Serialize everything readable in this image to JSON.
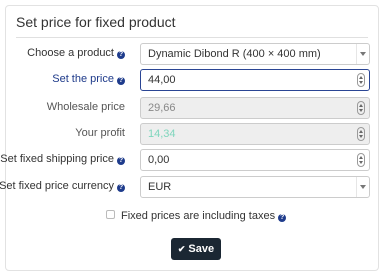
{
  "panel": {
    "title": "Set price for fixed product"
  },
  "fields": {
    "product": {
      "label": "Choose a product",
      "value": "Dynamic Dibond R (400 × 400 mm)"
    },
    "price": {
      "label": "Set the price",
      "value": "44,00"
    },
    "wholesale": {
      "label": "Wholesale price",
      "value": "29,66"
    },
    "profit": {
      "label": "Your profit",
      "value": "14,34"
    },
    "shipping": {
      "label": "Set fixed shipping price",
      "value": "0,00"
    },
    "currency": {
      "label": "Set fixed price currency",
      "value": "EUR"
    }
  },
  "taxes": {
    "label": "Fixed prices are including taxes",
    "checked": false
  },
  "save": {
    "label": "Save"
  },
  "icons": {
    "help": "help-circle-icon",
    "save": "check-icon"
  },
  "colors": {
    "accent": "#1f3c8c",
    "button": "#1b2733",
    "profit": "#7fd6bd"
  }
}
